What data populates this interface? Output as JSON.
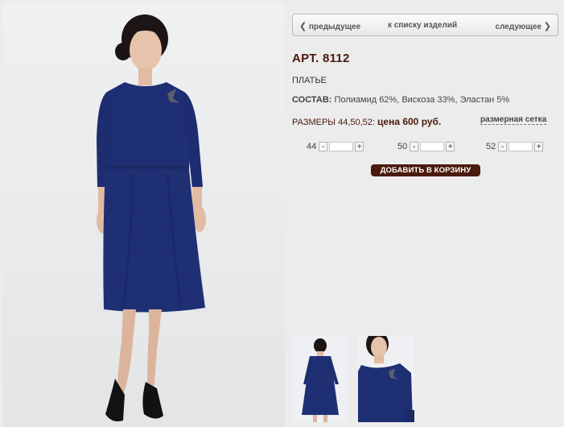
{
  "nav": {
    "prev": "предыдущее",
    "list": "к списку изделий",
    "next": "следующее"
  },
  "product": {
    "article": "АРТ. 8112",
    "type": "ПЛАТЬЕ",
    "composition_label": "СОСТАВ:",
    "composition_value": "Полиамид 62%, Вискоза 33%, Эластан 5%",
    "sizes_text": "РАЗМЕРЫ 44,50,52:",
    "price_text": "цена 600 руб.",
    "size_chart_link": "размерная сетка"
  },
  "quantities": [
    {
      "size": "44",
      "minus": "-",
      "plus": "+",
      "value": ""
    },
    {
      "size": "50",
      "minus": "-",
      "plus": "+",
      "value": ""
    },
    {
      "size": "52",
      "minus": "-",
      "plus": "+",
      "value": ""
    }
  ],
  "cart_button": "ДОБАВИТЬ В КОРЗИНУ",
  "colors": {
    "accent": "#4a1a0c",
    "dress": "#1f2f74"
  }
}
